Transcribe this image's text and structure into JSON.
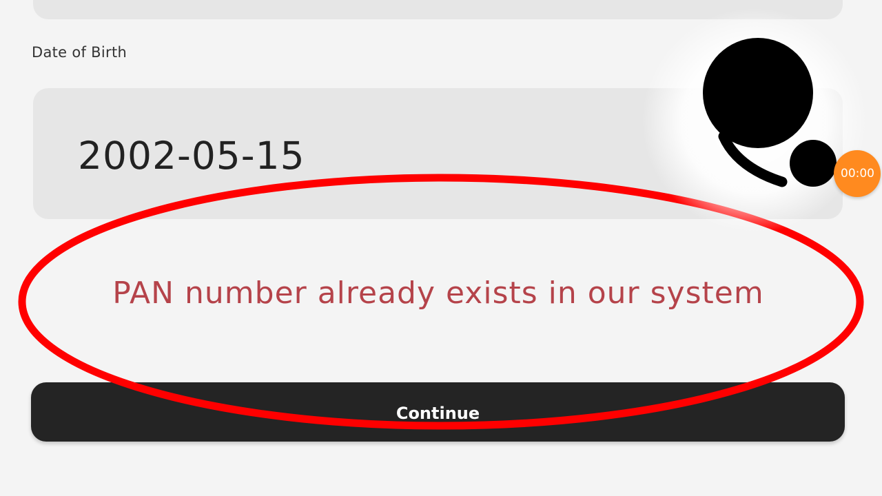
{
  "form": {
    "dob_label": "Date of Birth",
    "dob_value": "2002-05-15",
    "error_message": "PAN number already exists in our system",
    "continue_label": "Continue"
  },
  "overlay": {
    "timer": "00:00",
    "highlight_color": "#ff0000",
    "logo_color": "#000000",
    "timer_color": "#ff8a1f"
  },
  "colors": {
    "error_text": "#b5434a",
    "button_bg": "#242424",
    "field_bg": "#e6e6e6"
  }
}
